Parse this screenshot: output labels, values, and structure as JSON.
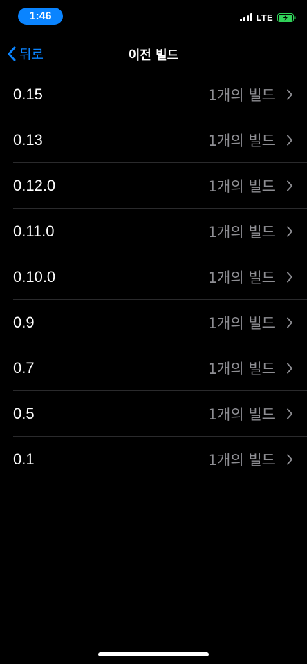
{
  "status_bar": {
    "time": "1:46",
    "network": "LTE",
    "signal_icon": "cellular-signal-icon",
    "battery_icon": "battery-charging-icon"
  },
  "nav": {
    "back_label": "뒤로",
    "title": "이전 빌드"
  },
  "builds": [
    {
      "version": "0.15",
      "count": "1개의 빌드"
    },
    {
      "version": "0.13",
      "count": "1개의 빌드"
    },
    {
      "version": "0.12.0",
      "count": "1개의 빌드"
    },
    {
      "version": "0.11.0",
      "count": "1개의 빌드"
    },
    {
      "version": "0.10.0",
      "count": "1개의 빌드"
    },
    {
      "version": "0.9",
      "count": "1개의 빌드"
    },
    {
      "version": "0.7",
      "count": "1개의 빌드"
    },
    {
      "version": "0.5",
      "count": "1개의 빌드"
    },
    {
      "version": "0.1",
      "count": "1개의 빌드"
    }
  ],
  "colors": {
    "accent": "#0a84ff",
    "background": "#000000",
    "secondary_text": "#8e8e93",
    "separator": "#2a2a2c",
    "battery_charging": "#30d158"
  }
}
